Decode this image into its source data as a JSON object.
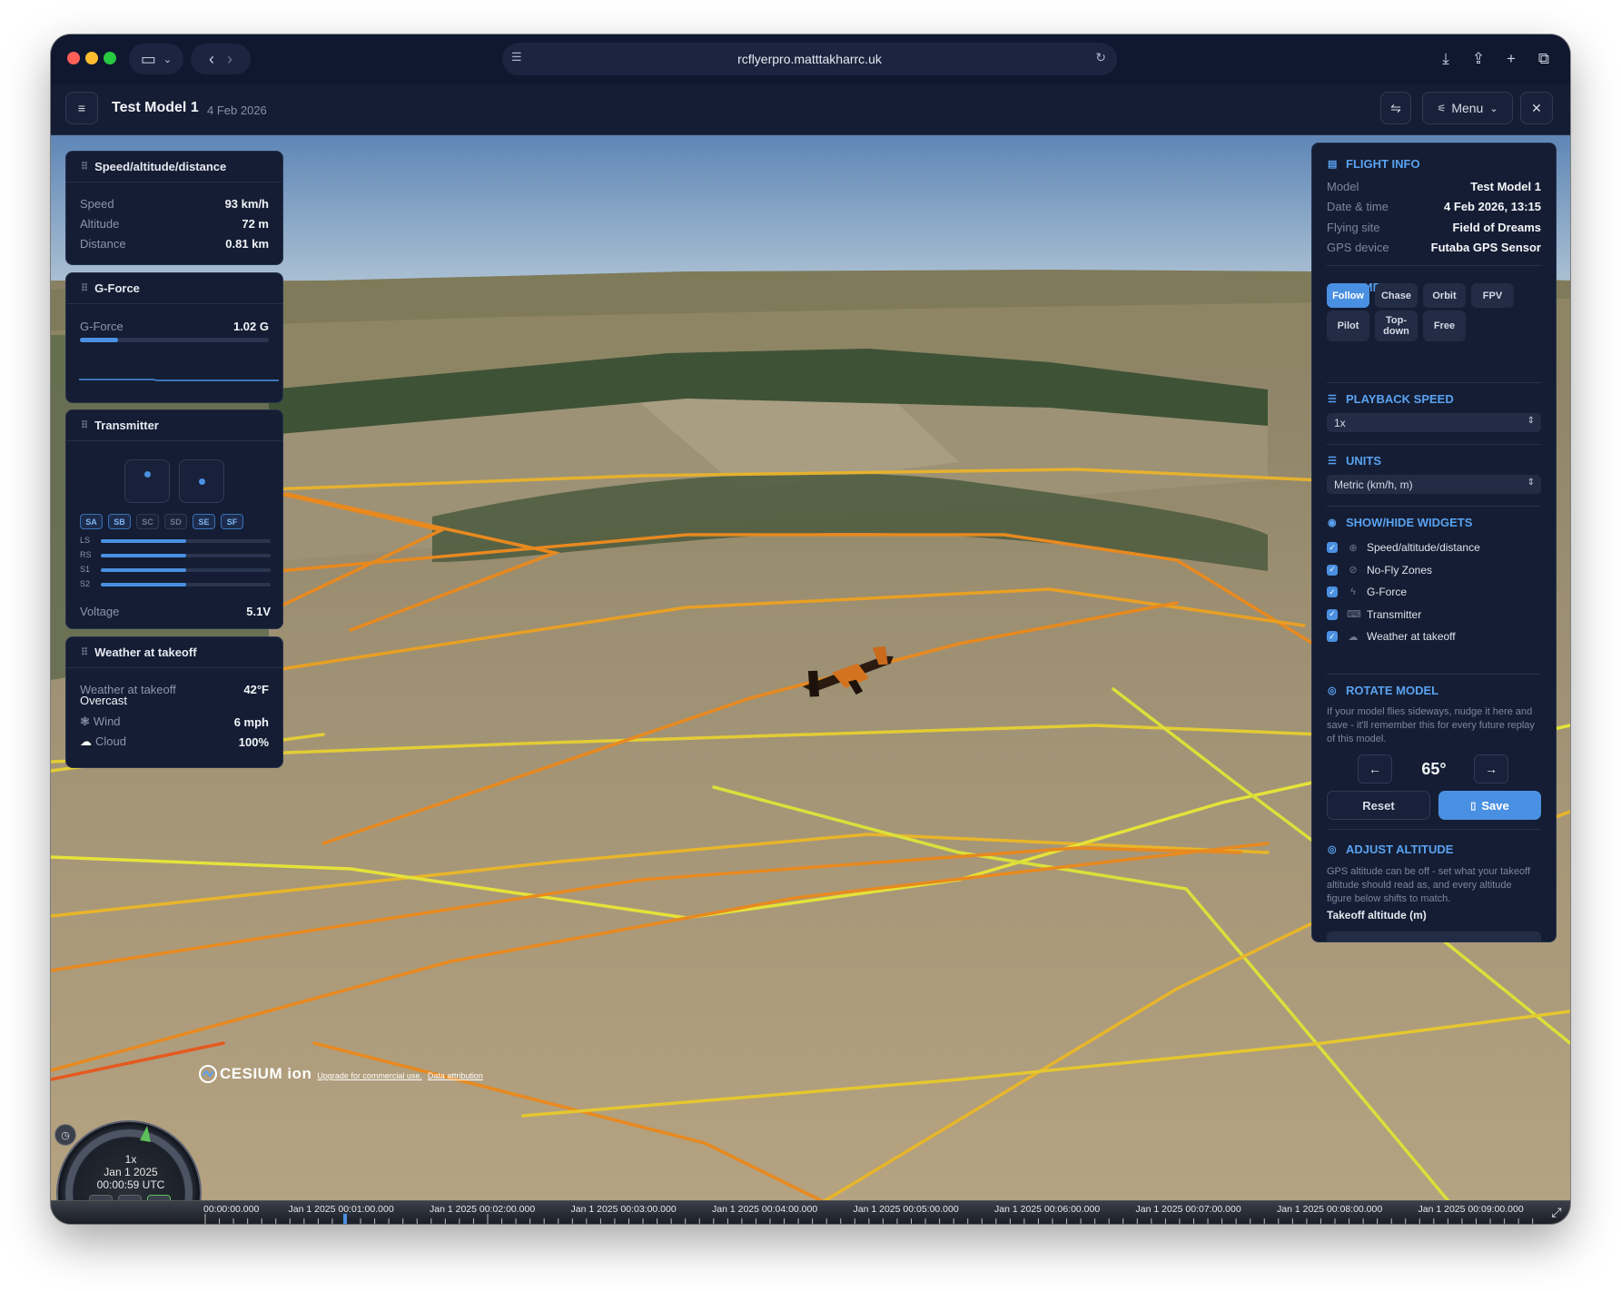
{
  "browser": {
    "url": "rcflyerpro.matttakharrc.uk"
  },
  "header": {
    "title": "Test Model 1",
    "date": "4 Feb 2026",
    "menu_label": "Menu"
  },
  "widgets": {
    "speed": {
      "title": "Speed/altitude/distance",
      "rows": [
        {
          "label": "Speed",
          "value": "93 km/h"
        },
        {
          "label": "Altitude",
          "value": "72 m"
        },
        {
          "label": "Distance",
          "value": "0.81 km"
        }
      ]
    },
    "gforce": {
      "title": "G-Force",
      "label": "G-Force",
      "value": "1.02 G",
      "bar_fraction": 0.2
    },
    "transmitter": {
      "title": "Transmitter",
      "switches": [
        "SA",
        "SB",
        "SC",
        "SD",
        "SE",
        "SF"
      ],
      "channels": [
        {
          "label": "LS",
          "fraction": 0.5
        },
        {
          "label": "RS",
          "fraction": 0.5
        },
        {
          "label": "S1",
          "fraction": 0.5
        },
        {
          "label": "S2",
          "fraction": 0.5
        }
      ],
      "voltage_label": "Voltage",
      "voltage_value": "5.1V"
    },
    "weather": {
      "title": "Weather at takeoff",
      "label": "Weather at takeoff",
      "temp": "42°F",
      "condition": "Overcast",
      "wind_label": "Wind",
      "wind_value": "6 mph",
      "cloud_label": "Cloud",
      "cloud_value": "100%"
    }
  },
  "panel": {
    "flight_info": {
      "title": "FLIGHT INFO",
      "rows": [
        {
          "label": "Model",
          "value": "Test Model 1"
        },
        {
          "label": "Date & time",
          "value": "4 Feb 2026, 13:15"
        },
        {
          "label": "Flying site",
          "value": "Field of Dreams"
        },
        {
          "label": "GPS device",
          "value": "Futaba GPS Sensor"
        }
      ]
    },
    "camera": {
      "title": "CAMERA",
      "buttons": [
        "Follow",
        "Chase",
        "Orbit",
        "FPV",
        "Pilot",
        "Top-down",
        "Free"
      ],
      "active": "Follow"
    },
    "playback": {
      "title": "PLAYBACK SPEED",
      "value": "1x"
    },
    "units": {
      "title": "UNITS",
      "value": "Metric (km/h, m)"
    },
    "widgets": {
      "title": "SHOW/HIDE WIDGETS",
      "items": [
        "Speed/altitude/distance",
        "No-Fly Zones",
        "G-Force",
        "Transmitter",
        "Weather at takeoff"
      ]
    },
    "rotate": {
      "title": "ROTATE MODEL",
      "help": "If your model flies sideways, nudge it here and save - it'll remember this for every future replay of this model.",
      "value": "65°",
      "reset_label": "Reset",
      "save_label": "Save"
    },
    "altitude": {
      "title": "ADJUST ALTITUDE",
      "help": "GPS altitude can be off - set what your takeoff altitude should read as, and every altitude figure below shifts to match.",
      "field_label": "Takeoff altitude (m)"
    }
  },
  "viewer": {
    "clock_speed": "1x",
    "clock_date": "Jan 1 2025",
    "clock_time": "00:00:59 UTC",
    "credit_logo": "CESIUM ion",
    "credit_upgrade": "Upgrade for commercial use.",
    "credit_attribution": "Data attribution",
    "timeline_labels": [
      "00:00:00.000",
      "Jan 1 2025 00:01:00.000",
      "Jan 1 2025 00:02:00.000",
      "Jan 1 2025 00:03:00.000",
      "Jan 1 2025 00:04:00.000",
      "Jan 1 2025 00:05:00.000",
      "Jan 1 2025 00:06:00.000",
      "Jan 1 2025 00:07:00.000",
      "Jan 1 2025 00:08:00.000",
      "Jan 1 2025 00:09:00.000"
    ]
  },
  "colors": {
    "accent": "#4a90e2",
    "panel_bg": "#141d33",
    "section_title": "#5aa2f0",
    "path_orange": "#e8891f",
    "path_yellow": "#e5e23a"
  }
}
